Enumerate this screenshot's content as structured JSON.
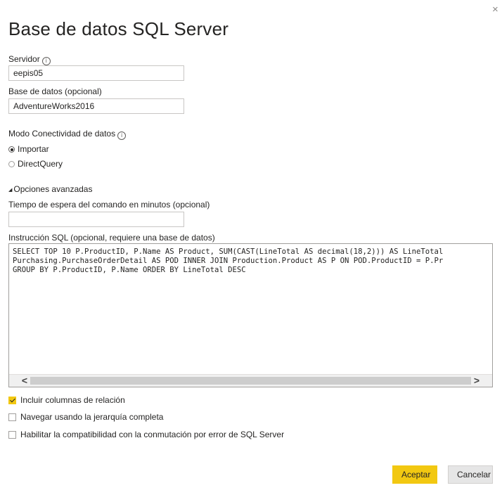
{
  "dialog": {
    "title": "Base de datos SQL Server",
    "close_glyph": "×"
  },
  "server": {
    "label": "Servidor",
    "value": "eepis05"
  },
  "database": {
    "label": "Base de datos (opcional)",
    "value": "AdventureWorks2016"
  },
  "connectivity": {
    "label": "Modo Conectividad de datos",
    "options": [
      {
        "label": "Importar",
        "selected": true
      },
      {
        "label": "DirectQuery",
        "selected": false
      }
    ]
  },
  "advanced": {
    "toggle_label": "Opciones avanzadas",
    "toggle_glyph": "◢",
    "timeout_label": "Tiempo de espera del comando en minutos (opcional)",
    "timeout_value": "",
    "sql_label": "Instrucción SQL (opcional, requiere una base de datos)",
    "sql_lines": [
      "SELECT TOP 10 P.ProductID, P.Name AS Product, SUM(CAST(LineTotal AS decimal(18,2))) AS LineTotal",
      "Purchasing.PurchaseOrderDetail AS POD INNER JOIN Production.Product AS P ON POD.ProductID = P.Pr",
      "GROUP BY P.ProductID, P.Name ORDER BY LineTotal DESC"
    ],
    "scroll_left": "<",
    "scroll_right": ">",
    "checkboxes": [
      {
        "label": "Incluir columnas de relación",
        "checked": true
      },
      {
        "label": "Navegar usando la jerarquía completa",
        "checked": false
      },
      {
        "label": "Habilitar la compatibilidad con la conmutación por error de SQL Server",
        "checked": false
      }
    ]
  },
  "buttons": {
    "ok": "Aceptar",
    "cancel": "Cancelar"
  },
  "colors": {
    "accent": "#f2c811",
    "text": "#252423",
    "border": "#c8c6c4"
  },
  "icons": [
    "close-icon",
    "info-icon",
    "expand-triangle-icon",
    "checkmark-icon"
  ]
}
